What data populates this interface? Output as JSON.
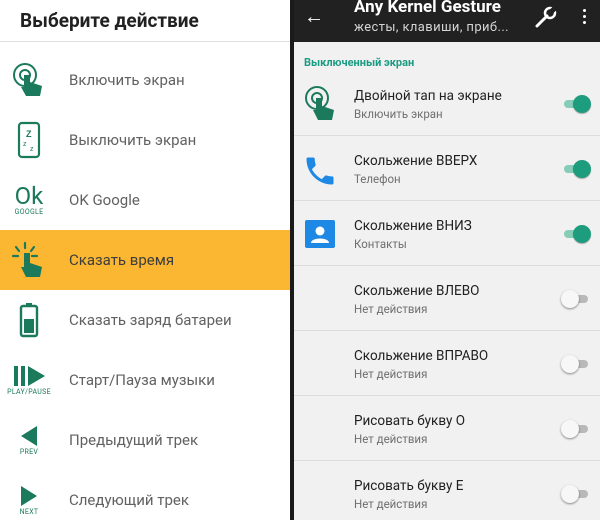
{
  "dialog": {
    "title": "Выберите действие",
    "items": [
      {
        "label": "Включить экран",
        "icon": "tap-hand-icon"
      },
      {
        "label": "Выключить экран",
        "icon": "phone-sleep-icon"
      },
      {
        "label": "OK Google",
        "icon": "ok-google-icon",
        "icon_text": "Ok",
        "icon_caption": "GOOGLE"
      },
      {
        "label": "Сказать время",
        "icon": "tap-hand-icon",
        "selected": true
      },
      {
        "label": "Сказать заряд батареи",
        "icon": "battery-icon"
      },
      {
        "label": "Старт/Пауза музыки",
        "icon": "play-pause-icon",
        "icon_caption": "PLAY/PAUSE"
      },
      {
        "label": "Предыдущий трек",
        "icon": "prev-track-icon",
        "icon_caption": "PREV"
      },
      {
        "label": "Следующий трек",
        "icon": "next-track-icon",
        "icon_caption": "NEXT"
      }
    ]
  },
  "app": {
    "title": "Any Kernel Gesture",
    "subtitle": "жесты, клавиши, приб...",
    "section": "Выключенный экран",
    "settings": [
      {
        "title": "Двойной тап на экране",
        "summary": "Включить экран",
        "on": true,
        "icon": "tap-hand-icon"
      },
      {
        "title": "Скольжение ВВЕРХ",
        "summary": "Телефон",
        "on": true,
        "icon": "phone-icon"
      },
      {
        "title": "Скольжение ВНИЗ",
        "summary": "Контакты",
        "on": true,
        "icon": "contacts-icon"
      },
      {
        "title": "Скольжение ВЛЕВО",
        "summary": "Нет действия",
        "on": false,
        "icon": ""
      },
      {
        "title": "Скольжение ВПРАВО",
        "summary": "Нет действия",
        "on": false,
        "icon": ""
      },
      {
        "title": "Рисовать букву О",
        "summary": "Нет действия",
        "on": false,
        "icon": ""
      },
      {
        "title": "Рисовать букву Е",
        "summary": "Нет действия",
        "on": false,
        "icon": ""
      }
    ]
  },
  "colors": {
    "accent": "#1e9c7e",
    "selected": "#fbb731",
    "icon_green": "#1b7a5b",
    "phone_blue": "#1e88e5"
  }
}
